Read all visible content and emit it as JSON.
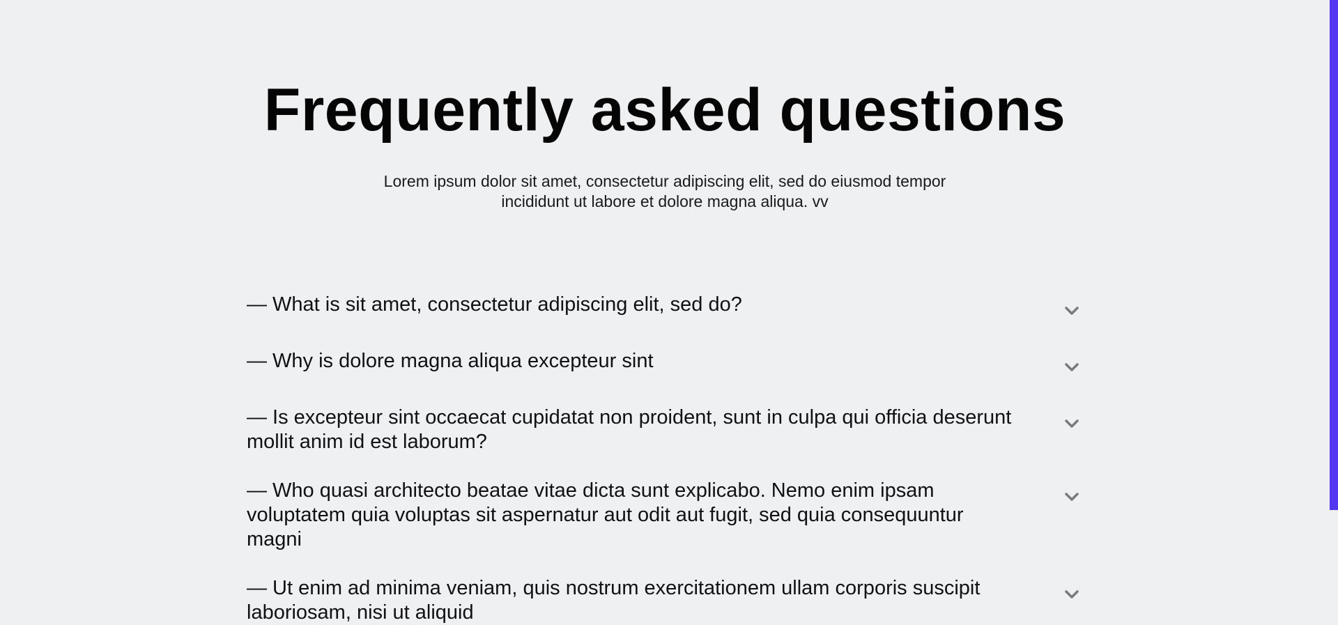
{
  "faq": {
    "title": "Frequently asked questions",
    "subtitle": "Lorem ipsum dolor sit amet, consectetur adipiscing elit, sed do eiusmod tempor incididunt ut labore et dolore magna aliqua. vv",
    "items": [
      {
        "question": "— What is sit amet, consectetur adipiscing elit, sed do?",
        "icon": "chevron-down-icon"
      },
      {
        "question": "— Why is dolore magna aliqua excepteur sint",
        "icon": "chevron-down-icon"
      },
      {
        "question": "— Is excepteur sint occaecat cupidatat non proident, sunt in culpa qui officia deserunt mollit anim id est laborum?",
        "icon": "chevron-down-icon"
      },
      {
        "question": "— Who quasi architecto beatae vitae dicta sunt explicabo. Nemo enim ipsam voluptatem quia voluptas sit aspernatur aut odit aut fugit, sed quia consequuntur magni",
        "icon": "chevron-down-icon"
      },
      {
        "question": "— Ut enim ad minima veniam, quis nostrum exercitationem ullam corporis suscipit laboriosam, nisi ut aliquid",
        "icon": "chevron-down-icon"
      }
    ]
  },
  "colors": {
    "background": "#eff0f2",
    "text": "#0b0b0d",
    "chevron": "#7a7a7e",
    "accent": "#5436f0"
  }
}
